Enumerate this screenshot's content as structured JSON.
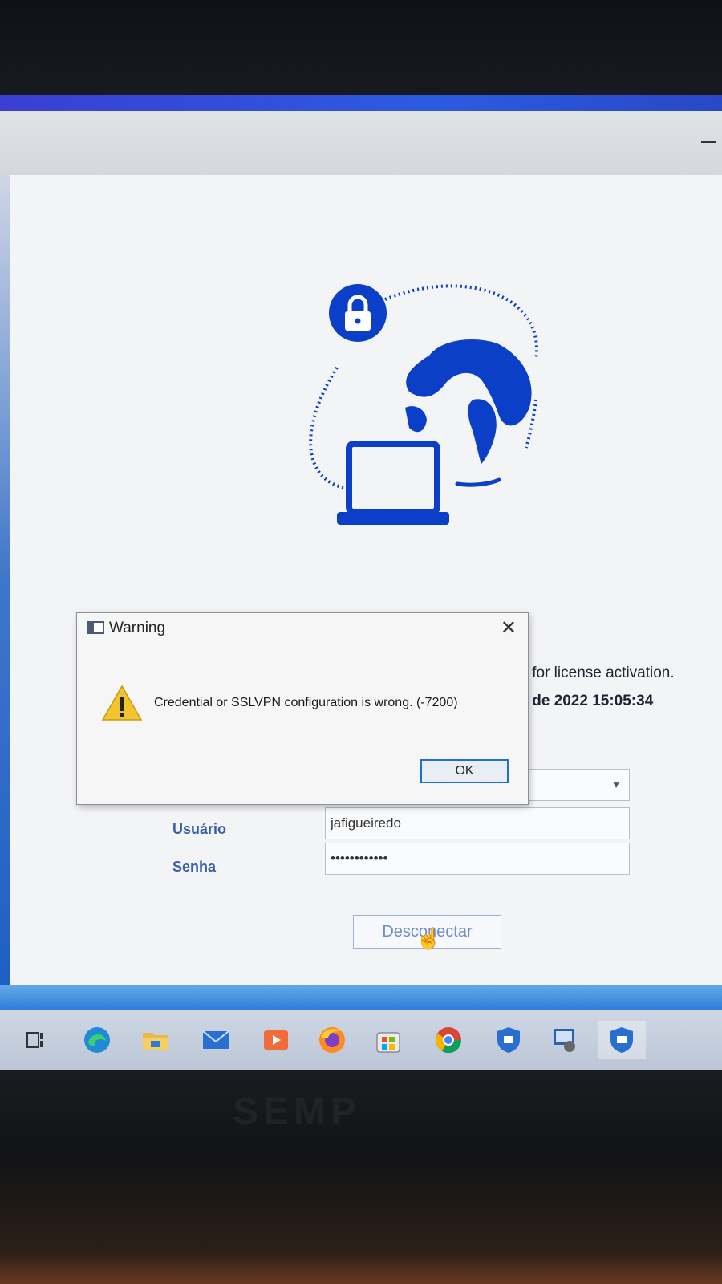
{
  "app": {
    "info_line_1": "IS for license activation.",
    "info_line_2": "ut de 2022 15:05:34",
    "form": {
      "username_label": "Usuário",
      "username_value": "jafigueiredo",
      "password_label": "Senha",
      "password_value": "••••••••••••",
      "select_value": ""
    },
    "disconnect_label": "Desconectar"
  },
  "dialog": {
    "title": "Warning",
    "message": "Credential or SSLVPN configuration is wrong. (-7200)",
    "ok_label": "OK"
  },
  "taskbar": {
    "items": [
      "task-view",
      "edge",
      "file-explorer",
      "mail",
      "media-player",
      "firefox",
      "store",
      "chrome",
      "vpn-shield",
      "remote-desktop",
      "vpn-client"
    ]
  },
  "monitor": {
    "brand": "SEMP"
  },
  "colors": {
    "accent_blue": "#0b3fc7",
    "window_blue_strip": "#2c5be0",
    "label_blue": "#3b5fa8"
  }
}
